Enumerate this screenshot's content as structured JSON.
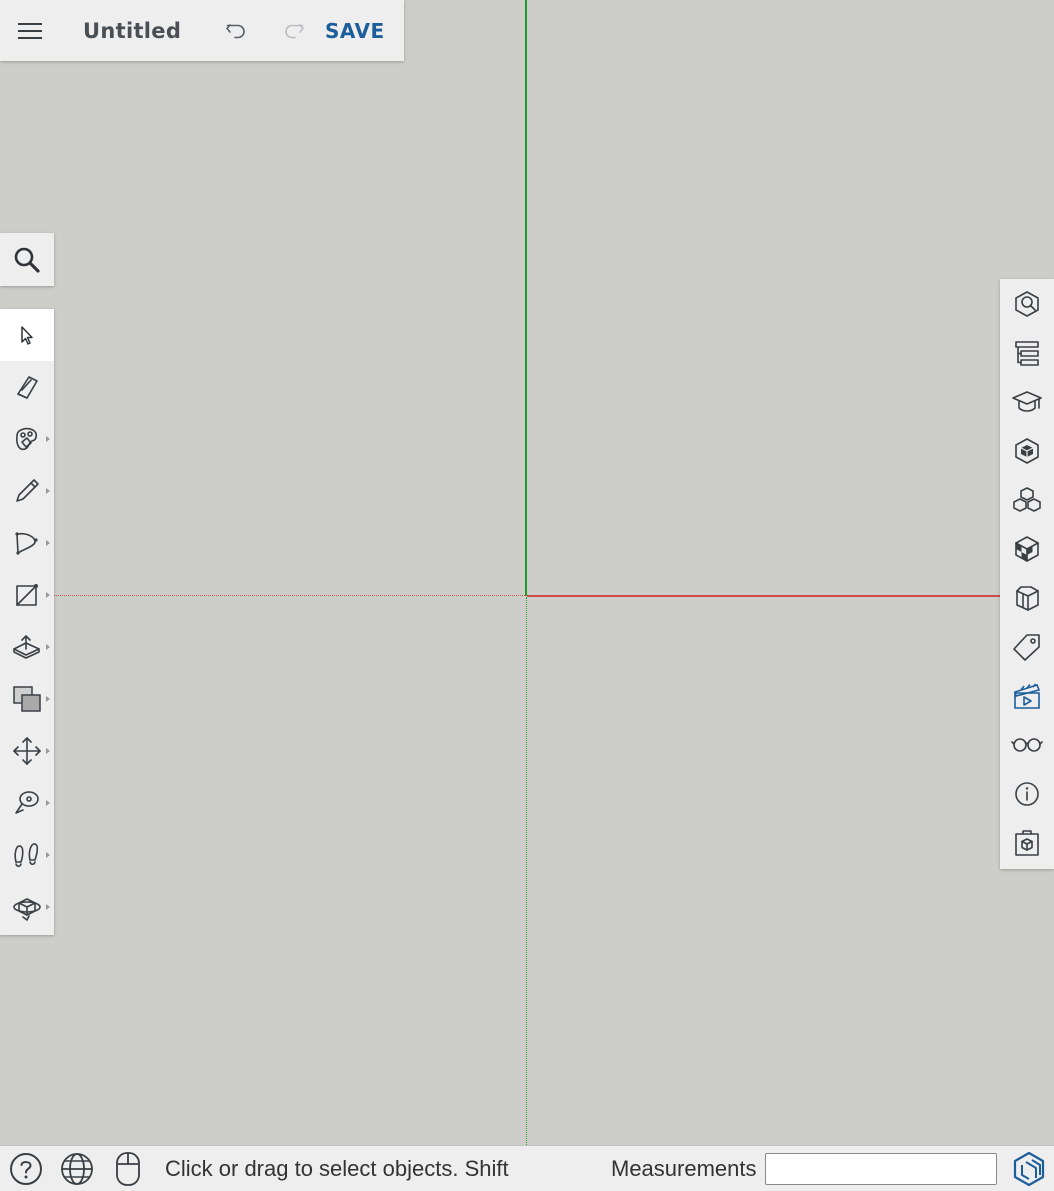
{
  "header": {
    "doc_title": "Untitled",
    "save_label": "SAVE",
    "icons": [
      "hamburger-menu-icon",
      "undo-icon",
      "redo-icon"
    ]
  },
  "search": {
    "icon": "search-icon"
  },
  "left_toolbar": {
    "tools": [
      {
        "name": "select",
        "icon": "cursor-arrow-icon",
        "active": true
      },
      {
        "name": "eraser",
        "icon": "eraser-icon"
      },
      {
        "name": "paint",
        "icon": "paint-bucket-icon",
        "submenu": true
      },
      {
        "name": "pencil",
        "icon": "pencil-icon",
        "submenu": true
      },
      {
        "name": "arc",
        "icon": "arc-icon",
        "submenu": true
      },
      {
        "name": "rectangle",
        "icon": "rectangle-icon",
        "submenu": true
      },
      {
        "name": "push-pull",
        "icon": "push-pull-icon",
        "submenu": true
      },
      {
        "name": "offset",
        "icon": "offset-icon",
        "submenu": true
      },
      {
        "name": "move",
        "icon": "move-icon",
        "submenu": true
      },
      {
        "name": "tape-measure",
        "icon": "tape-measure-icon",
        "submenu": true
      },
      {
        "name": "walk",
        "icon": "footprints-icon",
        "submenu": true
      },
      {
        "name": "orbit",
        "icon": "orbit-icon",
        "submenu": true
      }
    ]
  },
  "right_toolbar": {
    "panels": [
      {
        "name": "entity-info",
        "icon": "entity-info-icon"
      },
      {
        "name": "outliner",
        "icon": "outliner-icon"
      },
      {
        "name": "instructor",
        "icon": "graduation-cap-icon"
      },
      {
        "name": "materials",
        "icon": "materials-icon"
      },
      {
        "name": "components",
        "icon": "components-icon"
      },
      {
        "name": "styles",
        "icon": "styles-icon"
      },
      {
        "name": "scenes-3d",
        "icon": "scenes-3d-icon"
      },
      {
        "name": "tags",
        "icon": "tag-icon"
      },
      {
        "name": "scenes",
        "icon": "clapperboard-icon"
      },
      {
        "name": "display",
        "icon": "glasses-icon"
      },
      {
        "name": "info",
        "icon": "info-icon"
      },
      {
        "name": "3d-warehouse",
        "icon": "warehouse-box-icon"
      }
    ]
  },
  "status_bar": {
    "hint": "Click or drag to select objects. Shift",
    "measurements_label": "Measurements",
    "measurements_value": "",
    "icons": [
      "help-icon",
      "globe-icon",
      "mouse-icon",
      "sketchup-logo-icon"
    ]
  },
  "colors": {
    "canvas": "#cdcdc9",
    "green_axis": "#1e9a2a",
    "red_axis": "#d04a4a",
    "save_blue": "#1c5e9b",
    "toolbar_bg": "#eeeeee"
  }
}
